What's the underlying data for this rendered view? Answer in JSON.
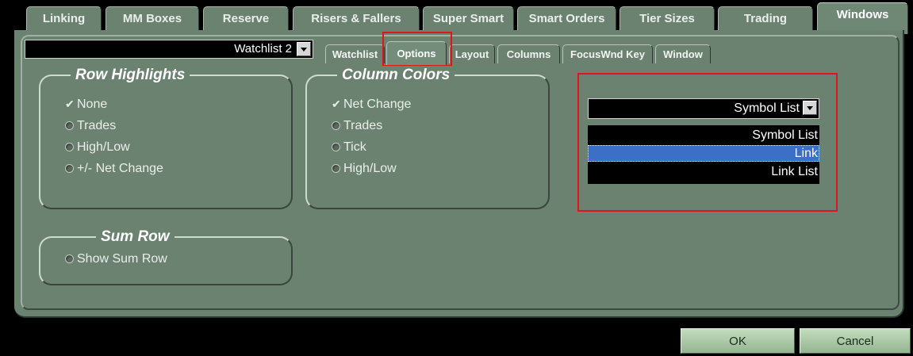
{
  "top_tabs": [
    "Linking",
    "MM Boxes",
    "Reserve",
    "Risers & Fallers",
    "Super Smart",
    "Smart Orders",
    "Tier Sizes",
    "Trading",
    "Windows"
  ],
  "active_top_tab": "Windows",
  "watchlist_select": {
    "value": "Watchlist 2"
  },
  "sub_tabs": [
    "Watchlist",
    "Options",
    "Layout",
    "Columns",
    "FocusWnd Key",
    "Window"
  ],
  "active_sub_tab": "Options",
  "row_highlights": {
    "title": "Row Highlights",
    "options": [
      "None",
      "Trades",
      "High/Low",
      "+/- Net Change"
    ],
    "selected": "None"
  },
  "column_colors": {
    "title": "Column Colors",
    "options": [
      "Net Change",
      "Trades",
      "Tick",
      "High/Low"
    ],
    "selected": "Net Change"
  },
  "sum_row": {
    "title": "Sum Row",
    "option": "Show Sum Row"
  },
  "symbol_select": {
    "value": "Symbol List",
    "options": [
      "Symbol List",
      "Link",
      "Link List"
    ],
    "highlighted": "Link"
  },
  "buttons": {
    "ok": "OK",
    "cancel": "Cancel"
  },
  "colors": {
    "panel": "#6b8271",
    "highlight_box": "#e0141c",
    "selection": "#3c6fc6"
  }
}
